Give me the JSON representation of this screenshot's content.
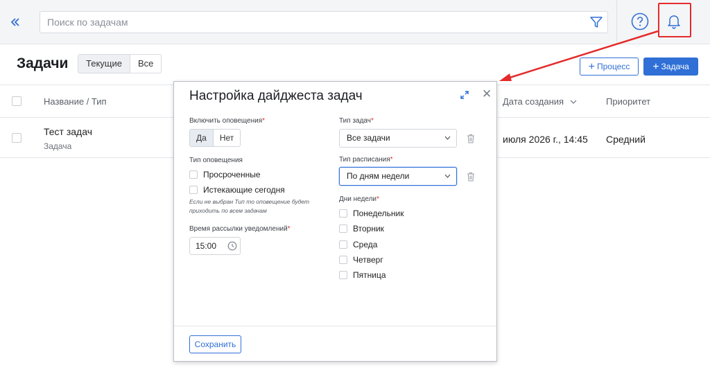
{
  "topbar": {
    "search_placeholder": "Поиск по задачам"
  },
  "header": {
    "title": "Задачи",
    "tabs": [
      "Текущие",
      "Все"
    ],
    "process_button": "Процесс",
    "task_button": "Задача"
  },
  "table": {
    "columns": [
      "Название / Тип",
      "Дата создания",
      "Приоритет"
    ],
    "rows": [
      {
        "name": "Тест задач",
        "type": "Задача",
        "created": "июля 2026 г., 14:45",
        "priority": "Средний"
      }
    ]
  },
  "modal": {
    "title": "Настройка дайджеста задач",
    "enable_label": "Включить оповещения",
    "enable_options": [
      "Да",
      "Нет"
    ],
    "notify_type_label": "Тип оповещения",
    "notify_types": [
      "Просроченные",
      "Истекающие сегодня"
    ],
    "hint": "Если не выбран Тип то оповещение будет приходить по всем задачам",
    "time_label": "Время рассылки уведомлений",
    "time_value": "15:00",
    "task_type_label": "Тип задач",
    "task_type_value": "Все задачи",
    "schedule_label": "Тип расписания",
    "schedule_value": "По дням недели",
    "weekdays_label": "Дни недели",
    "weekdays": [
      "Понедельник",
      "Вторник",
      "Среда",
      "Четверг",
      "Пятница"
    ],
    "save_button": "Сохранить",
    "required_mark": "*"
  },
  "colors": {
    "accent": "#2f6fd6",
    "highlight": "#e42b2b"
  }
}
